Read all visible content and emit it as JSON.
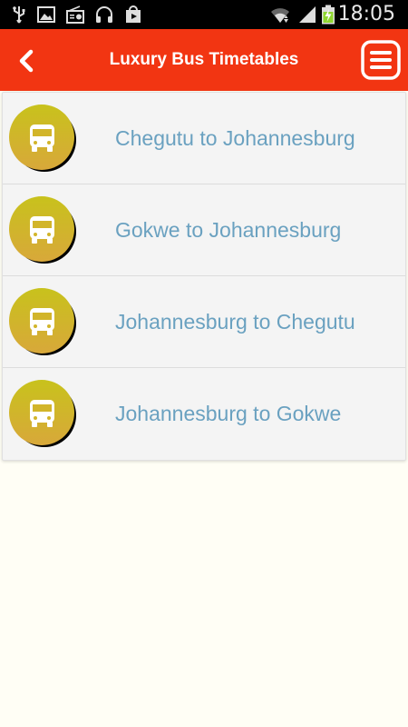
{
  "status_bar": {
    "time": "18:05",
    "icons": [
      "usb-icon",
      "image-icon",
      "radio-icon",
      "headphones-icon",
      "store-icon",
      "wifi-icon",
      "signal-icon",
      "battery-charging-icon"
    ]
  },
  "app_bar": {
    "title": "Luxury Bus Timetables",
    "back_icon": "chevron-left-icon",
    "menu_icon": "hamburger-menu-icon",
    "color": "#f23512"
  },
  "routes": [
    {
      "label": "Chegutu to Johannesburg",
      "icon": "bus-icon"
    },
    {
      "label": "Gokwe to Johannesburg",
      "icon": "bus-icon"
    },
    {
      "label": "Johannesburg to Chegutu",
      "icon": "bus-icon"
    },
    {
      "label": "Johannesburg to Gokwe",
      "icon": "bus-icon"
    }
  ],
  "colors": {
    "route_text": "#6aa1c0",
    "badge_top": "#c8c21c",
    "badge_bottom": "#d8a83a"
  }
}
